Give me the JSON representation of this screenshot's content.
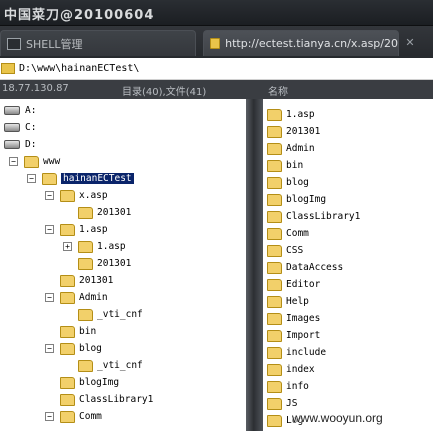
{
  "window": {
    "title": "中国菜刀@20100604"
  },
  "tabs": [
    {
      "label": "SHELL管理",
      "icon": "terminal-icon"
    },
    {
      "label": "http://ectest.tianya.cn/x.asp/20",
      "icon": "folder-icon"
    }
  ],
  "tab_close": "✕",
  "path": {
    "value": "D:\\www\\hainanECTest\\"
  },
  "info": {
    "ip": "18.77.130.87",
    "counts": "目录(40),文件(41)",
    "name_header": "名称"
  },
  "tree": [
    {
      "label": "A:",
      "kind": "drive"
    },
    {
      "label": "C:",
      "kind": "drive"
    },
    {
      "label": "D:",
      "kind": "drive"
    },
    {
      "label": "www",
      "kind": "folder",
      "toggle": "−"
    },
    {
      "label": "hainanECTest",
      "kind": "folder",
      "toggle": "−",
      "selected": true
    },
    {
      "label": "x.asp",
      "kind": "folder",
      "toggle": "−"
    },
    {
      "label": "201301",
      "kind": "folder"
    },
    {
      "label": "1.asp",
      "kind": "folder",
      "toggle": "−"
    },
    {
      "label": "1.asp",
      "kind": "folder",
      "toggle": "+"
    },
    {
      "label": "201301",
      "kind": "folder"
    },
    {
      "label": "201301",
      "kind": "folder"
    },
    {
      "label": "Admin",
      "kind": "folder",
      "toggle": "−"
    },
    {
      "label": "_vti_cnf",
      "kind": "folder"
    },
    {
      "label": "bin",
      "kind": "folder"
    },
    {
      "label": "blog",
      "kind": "folder",
      "toggle": "−"
    },
    {
      "label": "_vti_cnf",
      "kind": "folder"
    },
    {
      "label": "blogImg",
      "kind": "folder"
    },
    {
      "label": "ClassLibrary1",
      "kind": "folder"
    },
    {
      "label": "Comm",
      "kind": "folder",
      "toggle": "−"
    }
  ],
  "list": [
    "1.asp",
    "201301",
    "Admin",
    "bin",
    "blog",
    "blogImg",
    "ClassLibrary1",
    "Comm",
    "CSS",
    "DataAccess",
    "Editor",
    "Help",
    "Images",
    "Import",
    "include",
    "index",
    "info",
    "JS",
    "Log"
  ],
  "watermark": "www.wooyun.org",
  "colors": {
    "selection": "#0a246a",
    "folder": "#f2d06a",
    "chrome": "#2a2e33"
  }
}
